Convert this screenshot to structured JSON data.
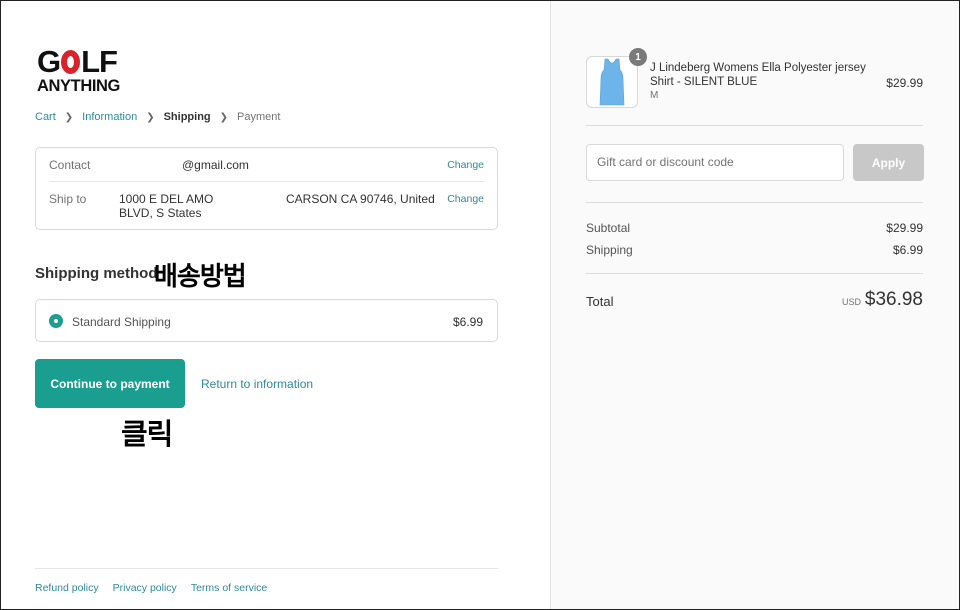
{
  "logo": {
    "line1_left": "G",
    "line1_right": "LF",
    "line2": "ANYTHING"
  },
  "breadcrumb": {
    "items": [
      {
        "label": "Cart"
      },
      {
        "label": "Information"
      },
      {
        "label": "Shipping"
      },
      {
        "label": "Payment"
      }
    ]
  },
  "review": {
    "contact_label": "Contact",
    "contact_value": "@gmail.com",
    "shipto_label": "Ship to",
    "shipto_line1": "1000 E DEL AMO BLVD, S States",
    "shipto_line2": "CARSON CA 90746, United",
    "change_label": "Change"
  },
  "shipping_method": {
    "heading": "Shipping method",
    "annotation": "배송방법",
    "option_name": "Standard Shipping",
    "option_price": "$6.99"
  },
  "actions": {
    "continue_label": "Continue to payment",
    "return_label": "Return to information",
    "click_annotation": "클릭"
  },
  "footer": {
    "links": [
      "Refund policy",
      "Privacy policy",
      "Terms of service"
    ]
  },
  "cart": {
    "quantity": "1",
    "product_name": "J Lindeberg Womens Ella Polyester jersey Shirt - SILENT BLUE",
    "product_variant": "M",
    "product_price": "$29.99",
    "discount_placeholder": "Gift card or discount code",
    "apply_label": "Apply",
    "subtotal_label": "Subtotal",
    "subtotal_value": "$29.99",
    "shipping_label": "Shipping",
    "shipping_value": "$6.99",
    "total_label": "Total",
    "total_currency": "USD",
    "total_value": "$36.98"
  },
  "colors": {
    "accent": "#1a9e8f",
    "link": "#2e8a9a",
    "logo_red": "#d8232a",
    "product_blue": "#6cb4ea"
  }
}
